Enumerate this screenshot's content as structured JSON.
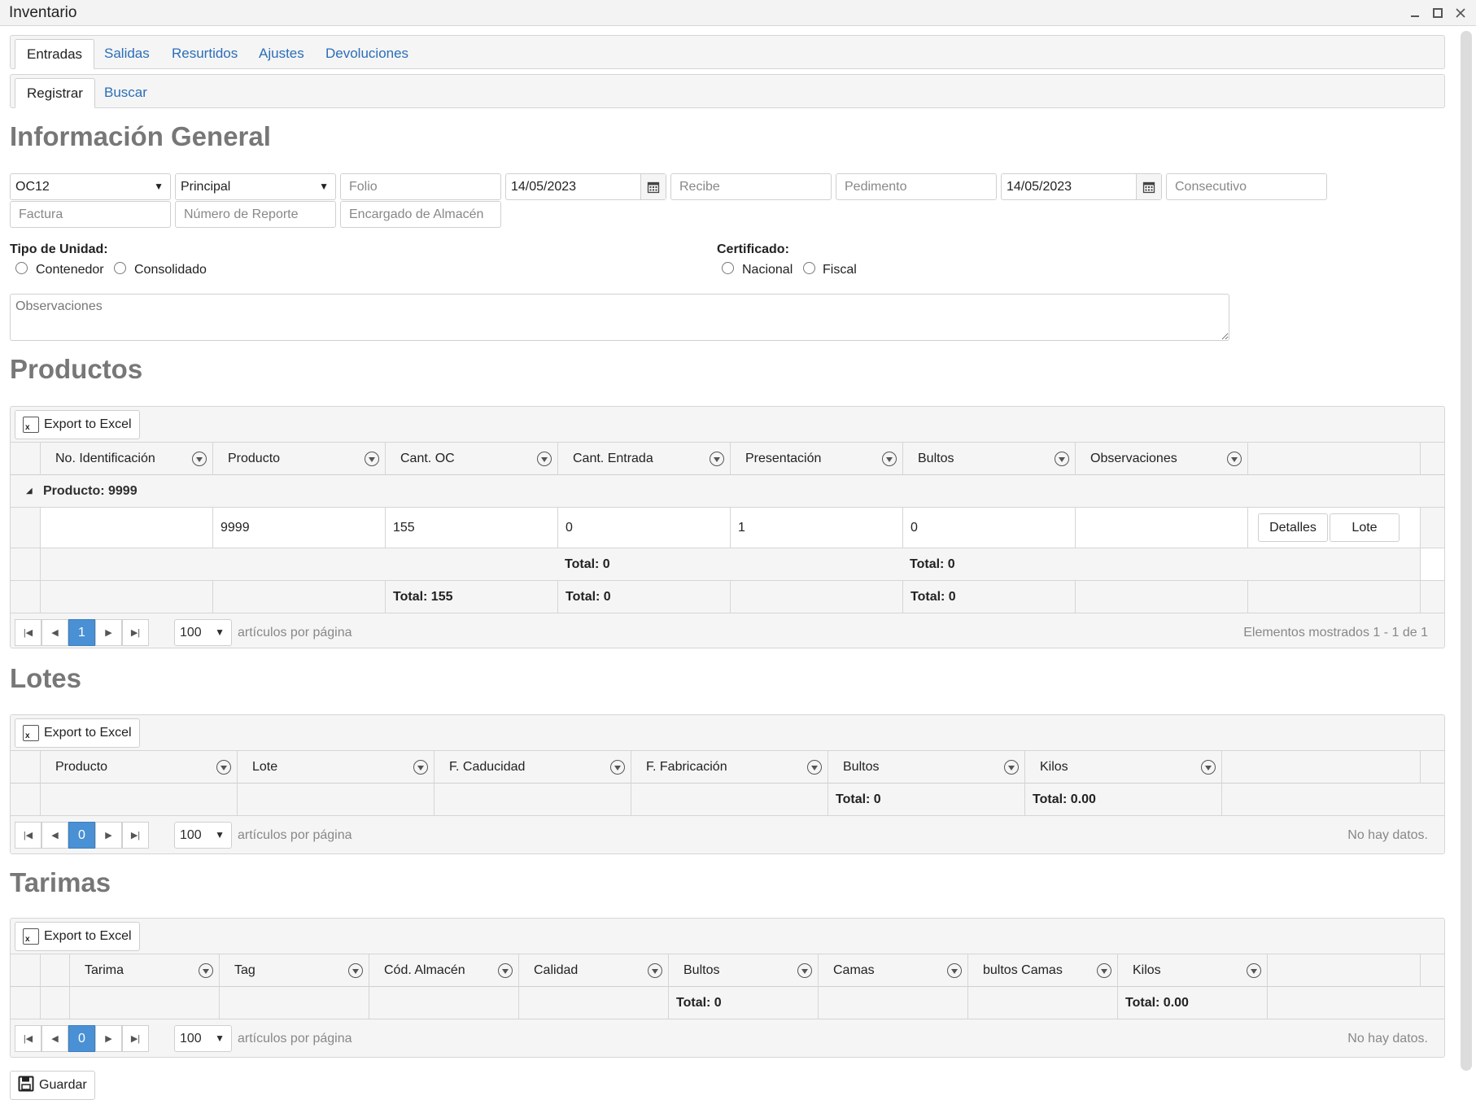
{
  "window": {
    "title": "Inventario"
  },
  "main_tabs": [
    {
      "label": "Entradas"
    },
    {
      "label": "Salidas"
    },
    {
      "label": "Resurtidos"
    },
    {
      "label": "Ajustes"
    },
    {
      "label": "Devoluciones"
    }
  ],
  "sub_tabs": [
    {
      "label": "Registrar"
    },
    {
      "label": "Buscar"
    }
  ],
  "general": {
    "title": "Información General",
    "orden_compra": "OC12",
    "almacen": "Principal",
    "folio_placeholder": "Folio",
    "fecha1": "14/05/2023",
    "recibe_placeholder": "Recibe",
    "pedimento_placeholder": "Pedimento",
    "fecha2": "14/05/2023",
    "consecutivo_placeholder": "Consecutivo",
    "factura_placeholder": "Factura",
    "reporte_placeholder": "Número de Reporte",
    "encargado_placeholder": "Encargado de Almacén",
    "tipo_unidad_label": "Tipo de Unidad:",
    "tipo_unidad_options": [
      "Contenedor",
      "Consolidado"
    ],
    "certificado_label": "Certificado:",
    "certificado_options": [
      "Nacional",
      "Fiscal"
    ],
    "observaciones_placeholder": "Observaciones"
  },
  "productos": {
    "title": "Productos",
    "export_label": "Export to Excel",
    "columns": [
      "No. Identificación",
      "Producto",
      "Cant. OC",
      "Cant. Entrada",
      "Presentación",
      "Bultos",
      "Observaciones"
    ],
    "group_label": "Producto: 9999",
    "row": {
      "id": "",
      "producto": "9999",
      "cant_oc": "155",
      "cant_entrada": "0",
      "presentacion": "1",
      "bultos": "0",
      "observaciones": ""
    },
    "row_buttons": {
      "detalles": "Detalles",
      "lote": "Lote"
    },
    "group_footer": {
      "cant_entrada": "Total: 0",
      "bultos": "Total: 0"
    },
    "footer": {
      "cant_oc": "Total: 155",
      "cant_entrada": "Total: 0",
      "bultos": "Total: 0"
    },
    "pager": {
      "page": "1",
      "page_size": "100",
      "per_page_text": "artículos por página",
      "info": "Elementos mostrados 1 - 1 de 1"
    }
  },
  "lotes": {
    "title": "Lotes",
    "export_label": "Export to Excel",
    "columns": [
      "Producto",
      "Lote",
      "F. Caducidad",
      "F. Fabricación",
      "Bultos",
      "Kilos"
    ],
    "footer": {
      "bultos": "Total: 0",
      "kilos": "Total: 0.00"
    },
    "pager": {
      "page": "0",
      "page_size": "100",
      "per_page_text": "artículos por página",
      "info": "No hay datos."
    }
  },
  "tarimas": {
    "title": "Tarimas",
    "export_label": "Export to Excel",
    "columns": [
      "Tarima",
      "Tag",
      "Cód. Almacén",
      "Calidad",
      "Bultos",
      "Camas",
      "bultos Camas",
      "Kilos"
    ],
    "footer": {
      "bultos": "Total: 0",
      "kilos": "Total: 0.00"
    },
    "pager": {
      "page": "0",
      "page_size": "100",
      "per_page_text": "artículos por página",
      "info": "No hay datos."
    }
  },
  "actions": {
    "save_label": "Guardar"
  },
  "colors": {
    "accent": "#4a90d4",
    "link": "#2b6eb8",
    "heading": "#777777"
  }
}
